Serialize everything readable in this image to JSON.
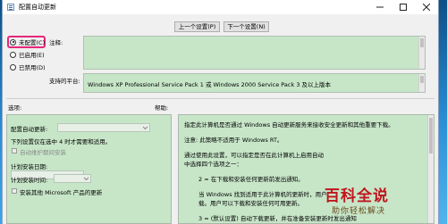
{
  "window": {
    "title": "配置自动更新"
  },
  "nav": {
    "prev_setting": "上一个设置(P)",
    "next_setting": "下一个设置(N)"
  },
  "state": {
    "options": [
      {
        "label": "未配置(C)",
        "selected": true
      },
      {
        "label": "已启用(E)",
        "selected": false
      },
      {
        "label": "已禁用(D)",
        "selected": false
      }
    ]
  },
  "comment": {
    "label": "注释:",
    "value": ""
  },
  "supported": {
    "label": "支持的平台:",
    "value": "Windows XP Professional Service Pack 1 或 Windows 2000 Service Pack 3 及以上版本"
  },
  "options_panel": {
    "header": "选项:",
    "configure_label": "配置自动更新:",
    "schedule_note": "下列设置仅在选中 4 时才需要和适用。",
    "maintenance_label": "自动维护期间安装",
    "install_day_label": "计划安装日期:",
    "install_time_label": "计划安装时间:",
    "other_products_label": "安装其他 Microsoft 产品的更新"
  },
  "help_panel": {
    "header": "帮助:",
    "lines": [
      "指定此计算机是否通过 Windows 自动更新服务来接收安全更新和其他重要下载。",
      "注意: 此策略不适用于 Windows RT。",
      "通过使用此设置，可以指定是否在此计算机上启用自动",
      "中选择四个选项之一：",
      "2 = 在下载和安装任何更新前发出通知。",
      "当 Windows 找到适用于此计算机的更新时，用户",
      "载。用户可以下载和安装任何可用更新。",
      "3 = (默认设置) 自动下载更新，并在准备安装更新时发出通知"
    ]
  },
  "watermark": {
    "title": "百科全说",
    "subtitle": "助你轻松解决"
  },
  "colors": {
    "panel_green": "#c7e6c8",
    "highlight": "#e5277a",
    "desktop": "#1b6fb3"
  }
}
